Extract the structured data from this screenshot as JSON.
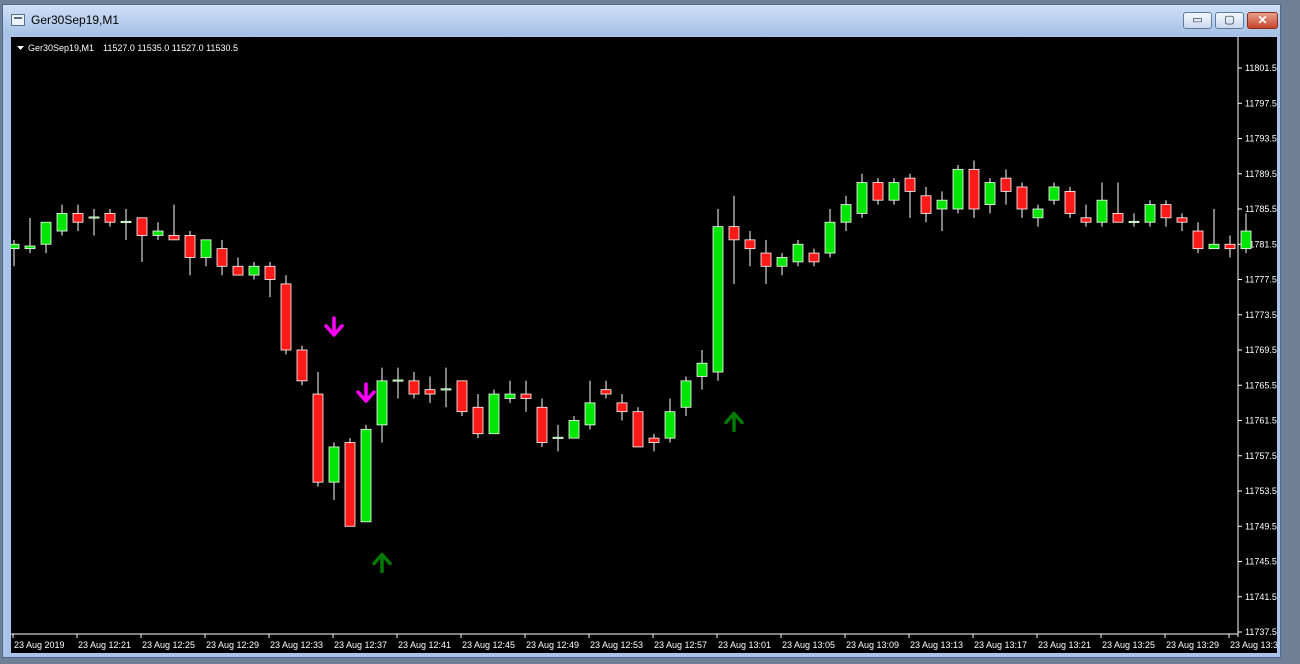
{
  "window": {
    "title": "Ger30Sep19,M1",
    "controls": {
      "minimize": "▭",
      "maximize": "▢",
      "close": "✕"
    }
  },
  "chart_info": {
    "symbol": "Ger30Sep19,M1",
    "ohlc": "11527.0 11535.0 11527.0 11530.5"
  },
  "colors": {
    "background": "#000000",
    "bull": "#00e600",
    "bear": "#ff1a1a",
    "down_arrow": "#ff00ff",
    "up_arrow": "#007a00",
    "text": "#ffffff"
  },
  "chart_data": {
    "type": "candlestick",
    "ylim": [
      11736,
      11806
    ],
    "y_ticks": [
      "11801.5",
      "11797.5",
      "11793.5",
      "11789.5",
      "11785.5",
      "11781.5",
      "11777.5",
      "11773.5",
      "11769.5",
      "11765.5",
      "11761.5",
      "11757.5",
      "11753.5",
      "11749.5",
      "11745.5",
      "11741.5",
      "11737.5"
    ],
    "x_ticks": [
      "23 Aug 2019",
      "23 Aug 12:21",
      "23 Aug 12:25",
      "23 Aug 12:29",
      "23 Aug 12:33",
      "23 Aug 12:37",
      "23 Aug 12:41",
      "23 Aug 12:45",
      "23 Aug 12:49",
      "23 Aug 12:53",
      "23 Aug 12:57",
      "23 Aug 13:01",
      "23 Aug 13:05",
      "23 Aug 13:09",
      "23 Aug 13:13",
      "23 Aug 13:17",
      "23 Aug 13:21",
      "23 Aug 13:25",
      "23 Aug 13:29",
      "23 Aug 13:33"
    ],
    "grid": false,
    "candles": [
      {
        "o": 11781.0,
        "h": 11782.0,
        "l": 11779.0,
        "c": 11781.5
      },
      {
        "o": 11781.0,
        "h": 11784.5,
        "l": 11780.5,
        "c": 11781.3
      },
      {
        "o": 11781.5,
        "h": 11784.0,
        "l": 11780.5,
        "c": 11784.0
      },
      {
        "o": 11783.0,
        "h": 11786.0,
        "l": 11782.5,
        "c": 11785.0
      },
      {
        "o": 11785.0,
        "h": 11786.0,
        "l": 11783.0,
        "c": 11784.0
      },
      {
        "o": 11784.5,
        "h": 11785.5,
        "l": 11782.5,
        "c": 11784.6
      },
      {
        "o": 11785.0,
        "h": 11785.5,
        "l": 11783.5,
        "c": 11784.0
      },
      {
        "o": 11784.0,
        "h": 11785.5,
        "l": 11782.0,
        "c": 11784.1
      },
      {
        "o": 11784.5,
        "h": 11784.5,
        "l": 11779.5,
        "c": 11782.5
      },
      {
        "o": 11782.5,
        "h": 11784.0,
        "l": 11782.0,
        "c": 11783.0
      },
      {
        "o": 11782.5,
        "h": 11786.0,
        "l": 11782.0,
        "c": 11782.0
      },
      {
        "o": 11782.5,
        "h": 11783.0,
        "l": 11778.0,
        "c": 11780.0
      },
      {
        "o": 11780.0,
        "h": 11782.0,
        "l": 11779.0,
        "c": 11782.0
      },
      {
        "o": 11781.0,
        "h": 11782.0,
        "l": 11778.0,
        "c": 11779.0
      },
      {
        "o": 11779.0,
        "h": 11780.0,
        "l": 11778.0,
        "c": 11778.0
      },
      {
        "o": 11778.0,
        "h": 11779.5,
        "l": 11777.5,
        "c": 11779.0
      },
      {
        "o": 11779.0,
        "h": 11779.5,
        "l": 11775.5,
        "c": 11777.5
      },
      {
        "o": 11777.0,
        "h": 11778.0,
        "l": 11769.0,
        "c": 11769.5
      },
      {
        "o": 11769.5,
        "h": 11770.0,
        "l": 11765.5,
        "c": 11766.0
      },
      {
        "o": 11764.5,
        "h": 11767.0,
        "l": 11754.0,
        "c": 11754.5
      },
      {
        "o": 11754.5,
        "h": 11759.0,
        "l": 11752.5,
        "c": 11758.5
      },
      {
        "o": 11759.0,
        "h": 11759.5,
        "l": 11749.5,
        "c": 11749.5
      },
      {
        "o": 11750.0,
        "h": 11761.0,
        "l": 11750.0,
        "c": 11760.5
      },
      {
        "o": 11761.0,
        "h": 11767.5,
        "l": 11759.0,
        "c": 11766.0
      },
      {
        "o": 11766.0,
        "h": 11767.5,
        "l": 11764.0,
        "c": 11766.1
      },
      {
        "o": 11766.0,
        "h": 11767.0,
        "l": 11764.0,
        "c": 11764.5
      },
      {
        "o": 11765.0,
        "h": 11766.5,
        "l": 11763.5,
        "c": 11764.5
      },
      {
        "o": 11765.0,
        "h": 11767.5,
        "l": 11763.0,
        "c": 11765.1
      },
      {
        "o": 11766.0,
        "h": 11766.0,
        "l": 11762.0,
        "c": 11762.5
      },
      {
        "o": 11763.0,
        "h": 11764.5,
        "l": 11759.5,
        "c": 11760.0
      },
      {
        "o": 11760.0,
        "h": 11765.0,
        "l": 11760.0,
        "c": 11764.5
      },
      {
        "o": 11764.0,
        "h": 11766.0,
        "l": 11763.5,
        "c": 11764.5
      },
      {
        "o": 11764.5,
        "h": 11766.0,
        "l": 11762.5,
        "c": 11764.0
      },
      {
        "o": 11763.0,
        "h": 11764.0,
        "l": 11758.5,
        "c": 11759.0
      },
      {
        "o": 11759.5,
        "h": 11761.0,
        "l": 11758.0,
        "c": 11759.6
      },
      {
        "o": 11759.5,
        "h": 11762.0,
        "l": 11759.5,
        "c": 11761.5
      },
      {
        "o": 11761.0,
        "h": 11766.0,
        "l": 11760.5,
        "c": 11763.5
      },
      {
        "o": 11765.0,
        "h": 11766.0,
        "l": 11764.0,
        "c": 11764.5
      },
      {
        "o": 11763.5,
        "h": 11764.5,
        "l": 11761.5,
        "c": 11762.5
      },
      {
        "o": 11762.5,
        "h": 11763.0,
        "l": 11758.5,
        "c": 11758.5
      },
      {
        "o": 11759.5,
        "h": 11760.0,
        "l": 11758.0,
        "c": 11759.0
      },
      {
        "o": 11759.5,
        "h": 11764.0,
        "l": 11759.0,
        "c": 11762.5
      },
      {
        "o": 11763.0,
        "h": 11766.5,
        "l": 11762.0,
        "c": 11766.0
      },
      {
        "o": 11766.5,
        "h": 11769.5,
        "l": 11765.0,
        "c": 11768.0
      },
      {
        "o": 11767.0,
        "h": 11785.5,
        "l": 11766.0,
        "c": 11783.5
      },
      {
        "o": 11783.5,
        "h": 11787.0,
        "l": 11777.0,
        "c": 11782.0
      },
      {
        "o": 11782.0,
        "h": 11783.0,
        "l": 11779.0,
        "c": 11781.0
      },
      {
        "o": 11780.5,
        "h": 11782.0,
        "l": 11777.0,
        "c": 11779.0
      },
      {
        "o": 11779.0,
        "h": 11780.5,
        "l": 11778.0,
        "c": 11780.0
      },
      {
        "o": 11779.5,
        "h": 11782.0,
        "l": 11779.0,
        "c": 11781.5
      },
      {
        "o": 11780.5,
        "h": 11781.0,
        "l": 11779.0,
        "c": 11779.5
      },
      {
        "o": 11780.5,
        "h": 11785.5,
        "l": 11780.0,
        "c": 11784.0
      },
      {
        "o": 11784.0,
        "h": 11787.0,
        "l": 11783.0,
        "c": 11786.0
      },
      {
        "o": 11785.0,
        "h": 11789.5,
        "l": 11784.5,
        "c": 11788.5
      },
      {
        "o": 11788.5,
        "h": 11789.0,
        "l": 11786.0,
        "c": 11786.5
      },
      {
        "o": 11786.5,
        "h": 11789.0,
        "l": 11786.0,
        "c": 11788.5
      },
      {
        "o": 11789.0,
        "h": 11789.5,
        "l": 11784.5,
        "c": 11787.5
      },
      {
        "o": 11787.0,
        "h": 11788.0,
        "l": 11784.0,
        "c": 11785.0
      },
      {
        "o": 11785.5,
        "h": 11787.5,
        "l": 11783.0,
        "c": 11786.5
      },
      {
        "o": 11785.5,
        "h": 11790.5,
        "l": 11785.0,
        "c": 11790.0
      },
      {
        "o": 11790.0,
        "h": 11791.0,
        "l": 11784.5,
        "c": 11785.5
      },
      {
        "o": 11786.0,
        "h": 11789.0,
        "l": 11785.0,
        "c": 11788.5
      },
      {
        "o": 11789.0,
        "h": 11790.0,
        "l": 11786.0,
        "c": 11787.5
      },
      {
        "o": 11788.0,
        "h": 11788.5,
        "l": 11784.5,
        "c": 11785.5
      },
      {
        "o": 11784.5,
        "h": 11786.0,
        "l": 11783.5,
        "c": 11785.5
      },
      {
        "o": 11786.5,
        "h": 11788.5,
        "l": 11786.0,
        "c": 11788.0
      },
      {
        "o": 11787.5,
        "h": 11788.0,
        "l": 11784.5,
        "c": 11785.0
      },
      {
        "o": 11784.5,
        "h": 11786.0,
        "l": 11783.5,
        "c": 11784.0
      },
      {
        "o": 11784.0,
        "h": 11788.5,
        "l": 11783.5,
        "c": 11786.5
      },
      {
        "o": 11785.0,
        "h": 11788.5,
        "l": 11784.0,
        "c": 11784.0
      },
      {
        "o": 11784.0,
        "h": 11785.0,
        "l": 11783.5,
        "c": 11784.1
      },
      {
        "o": 11784.0,
        "h": 11786.5,
        "l": 11783.5,
        "c": 11786.0
      },
      {
        "o": 11786.0,
        "h": 11786.5,
        "l": 11783.5,
        "c": 11784.5
      },
      {
        "o": 11784.5,
        "h": 11785.0,
        "l": 11783.0,
        "c": 11784.0
      },
      {
        "o": 11783.0,
        "h": 11784.0,
        "l": 11780.5,
        "c": 11781.0
      },
      {
        "o": 11781.0,
        "h": 11785.5,
        "l": 11781.0,
        "c": 11781.5
      },
      {
        "o": 11781.5,
        "h": 11782.5,
        "l": 11780.0,
        "c": 11781.0
      },
      {
        "o": 11781.0,
        "h": 11785.0,
        "l": 11780.5,
        "c": 11783.0
      }
    ],
    "signals": [
      {
        "index": 20,
        "type": "down",
        "price": 11772.0
      },
      {
        "index": 22,
        "type": "down",
        "price": 11764.5
      },
      {
        "index": 23,
        "type": "up",
        "price": 11745.5
      },
      {
        "index": 45,
        "type": "up",
        "price": 11761.5
      }
    ]
  }
}
